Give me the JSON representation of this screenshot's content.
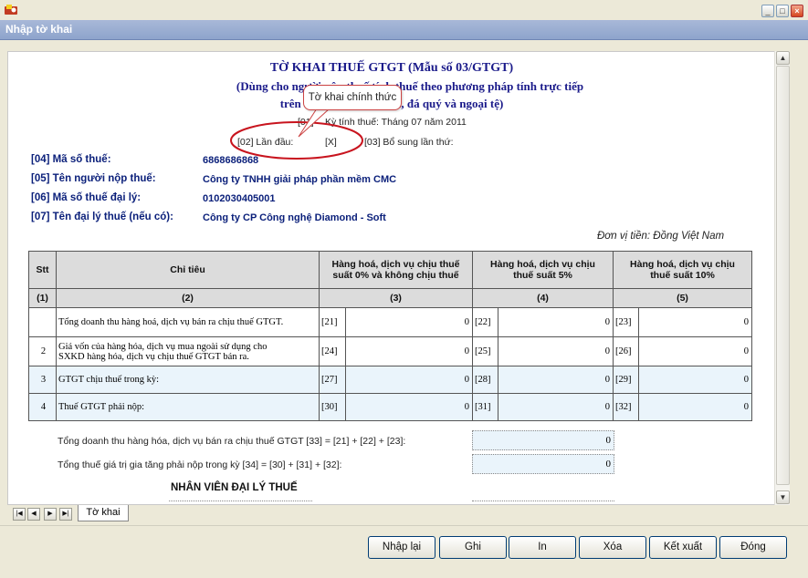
{
  "window": {
    "icon": "app-icon",
    "title": "Nhập tờ khai",
    "controls": [
      "minimize-icon",
      "maximize-icon",
      "close-icon"
    ]
  },
  "form": {
    "title": "TỜ KHAI THUẾ GTGT (Mẫu số 03/GTGT)",
    "subtitle1": "(Dùng cho người nộp thuế tính thuế theo phương pháp tính trực tiếp",
    "subtitle2": "trên GTGT và                               vàng bạc, đá quý và ngoại tệ)",
    "period_code": "[01]",
    "period_text": "Kỳ tính thuế: Tháng 07 năm 2011",
    "first_label": "[02] Lần đầu:",
    "first_value": "[X]",
    "supplement_label": "[03] Bổ sung lần thứ:",
    "callout": "Tờ khai chính thức",
    "fields": [
      {
        "label": "[04] Mã số thuế:",
        "value": "6868686868"
      },
      {
        "label": "[05] Tên người nộp thuế:",
        "value": "Công ty TNHH giải pháp phần mềm CMC"
      },
      {
        "label": "[06] Mã số thuế đại lý:",
        "value": "0102030405001"
      },
      {
        "label": "[07] Tên đại lý thuế (nếu có):",
        "value": "Công ty CP Công nghệ Diamond - Soft"
      }
    ],
    "unit": "Đơn vị tiền: Đồng Việt Nam"
  },
  "table": {
    "headers": {
      "stt": "Stt",
      "chitieu": "Chỉ tiêu",
      "col3_line1": "Hàng hoá, dịch vụ chịu thuế",
      "col3_line2": "suất 0% và không chịu thuế",
      "col4_line1": "Hàng hoá, dịch vụ chịu",
      "col4_line2": "thuế suất 5%",
      "col5_line1": "Hàng hoá, dịch vụ chịu",
      "col5_line2": "thuế suất 10%"
    },
    "numbers": [
      "(1)",
      "(2)",
      "(3)",
      "(4)",
      "(5)"
    ],
    "rows": [
      {
        "stt": "",
        "desc1": "Tổng doanh thu hàng hoá, dịch vụ bán ra chịu thuế GTGT.",
        "desc2": "",
        "c1": "[21]",
        "v1": "0",
        "c2": "[22]",
        "v2": "0",
        "c3": "[23]",
        "v3": "0"
      },
      {
        "stt": "2",
        "desc1": "Giá vốn của hàng hóa, dịch vụ mua ngoài sử dụng cho",
        "desc2": "SXKD hàng hóa, dịch vụ chịu thuế GTGT bán ra.",
        "c1": "[24]",
        "v1": "0",
        "c2": "[25]",
        "v2": "0",
        "c3": "[26]",
        "v3": "0"
      },
      {
        "stt": "3",
        "desc1": "GTGT chịu thuế trong kỳ:",
        "desc2": "",
        "c1": "[27]",
        "v1": "0",
        "c2": "[28]",
        "v2": "0",
        "c3": "[29]",
        "v3": "0"
      },
      {
        "stt": "4",
        "desc1": "Thuế GTGT phải nộp:",
        "desc2": "",
        "c1": "[30]",
        "v1": "0",
        "c2": "[31]",
        "v2": "0",
        "c3": "[32]",
        "v3": "0"
      }
    ]
  },
  "totals": [
    {
      "label": "Tổng doanh thu hàng hóa, dịch vụ bán ra chịu thuế GTGT [33] = [21] + [22] + [23]:",
      "value": "0"
    },
    {
      "label": "Tổng thuế giá trị gia tăng phải nộp trong kỳ [34] = [30] + [31] + [32]:",
      "value": "0"
    }
  ],
  "agent_title": "NHÂN VIÊN ĐẠI LÝ THUẾ",
  "sheet_tab": "Tờ khai",
  "buttons": {
    "reload": "Nhập lại",
    "save": "Ghi",
    "print": "In",
    "delete": "Xóa",
    "export": "Kết xuất",
    "close": "Đóng"
  }
}
